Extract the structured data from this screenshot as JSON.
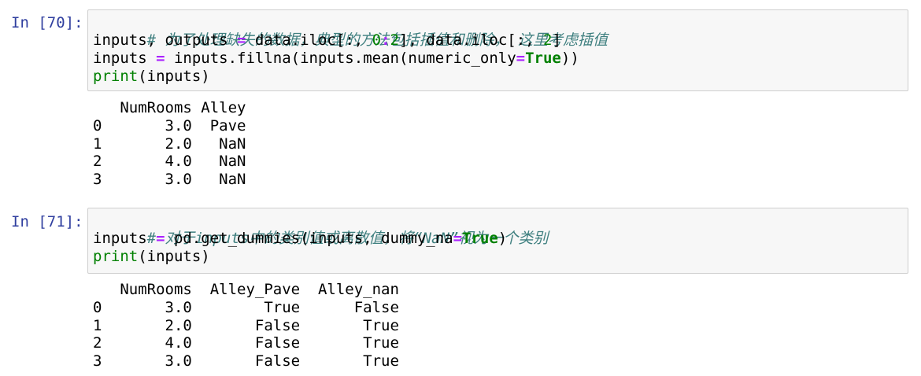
{
  "cells": [
    {
      "prompt": "In [70]:",
      "code": {
        "comment": "# 为了处理缺失的数据，典型的方法包括插值和删除， 这里考虑插值",
        "line2": {
          "a": "inputs, outputs ",
          "eq": "=",
          "b": " data.iloc[:, ",
          "n0": "0",
          "colon": ":",
          "n2": "2",
          "c": "], data.iloc[:, ",
          "n2b": "2",
          "d": "]"
        },
        "line3": {
          "a": "inputs ",
          "eq": "=",
          "b": " inputs.fillna(inputs.mean(numeric_only",
          "eq2": "=",
          "kw": "True",
          "c": "))"
        },
        "line4": {
          "fn": "print",
          "rest": "(inputs)"
        }
      },
      "output": [
        "   NumRooms Alley",
        "0       3.0  Pave",
        "1       2.0   NaN",
        "2       4.0   NaN",
        "3       3.0   NaN"
      ]
    },
    {
      "prompt": "In [71]:",
      "code": {
        "comment": "# 对于inputs中的类别值或离散值，将“NaN”视为一个类别",
        "line2": {
          "a": "inputs ",
          "eq": "=",
          "b": " pd.get_dummies(inputs, dummy_na",
          "eq2": "=",
          "kw": "True",
          "c": ")"
        },
        "line3": {
          "fn": "print",
          "rest": "(inputs)"
        }
      },
      "output": [
        "   NumRooms  Alley_Pave  Alley_nan",
        "0       3.0        True      False",
        "1       2.0       False       True",
        "2       4.0       False       True",
        "3       3.0       False       True"
      ]
    }
  ],
  "colors": {
    "prompt": "#303f9f",
    "comment": "#408080",
    "operator": "#aa22ff",
    "number": "#008000",
    "keyword": "#008000",
    "cell_background": "#f7f7f7",
    "cell_border": "#cfcfcf"
  }
}
